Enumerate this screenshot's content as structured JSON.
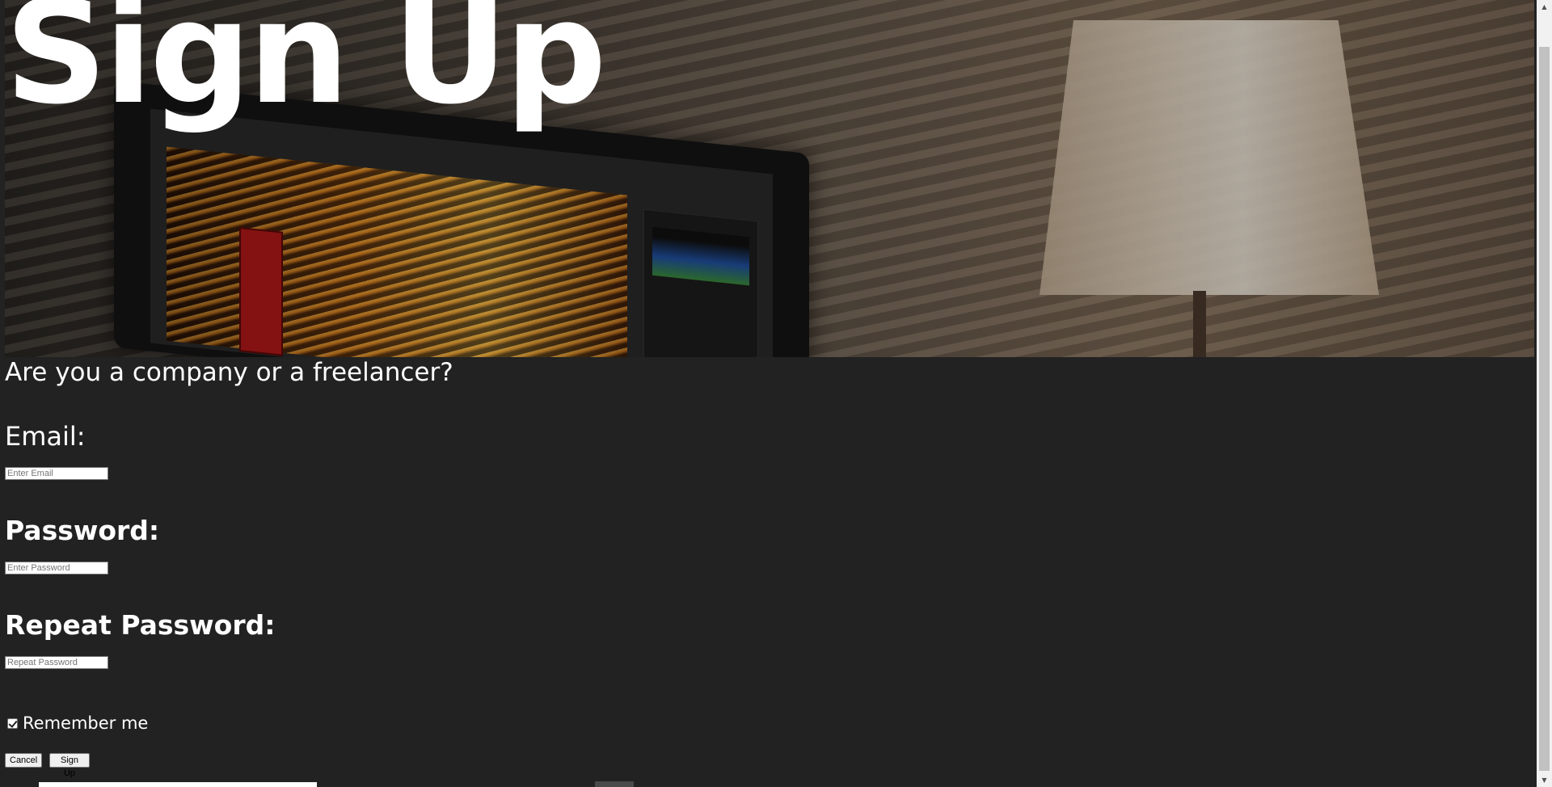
{
  "hero": {
    "title": "Sign Up"
  },
  "form": {
    "question": "Are you a company or a freelancer?",
    "email_label": "Email:",
    "email_placeholder": "Enter Email",
    "email_value": "",
    "password_label": "Password:",
    "password_placeholder": "Enter Password",
    "password_value": "",
    "repeat_label": "Repeat Password:",
    "repeat_placeholder": "Repeat Password",
    "repeat_value": "",
    "remember_label": "Remember me",
    "remember_checked": true,
    "cancel_label": "Cancel",
    "signup_label": "Sign Up"
  },
  "scrollbar": {
    "up_icon": "scroll-up-arrow-icon",
    "down_icon": "scroll-down-arrow-icon"
  },
  "colors": {
    "background": "#222222",
    "text": "#ffffff"
  }
}
